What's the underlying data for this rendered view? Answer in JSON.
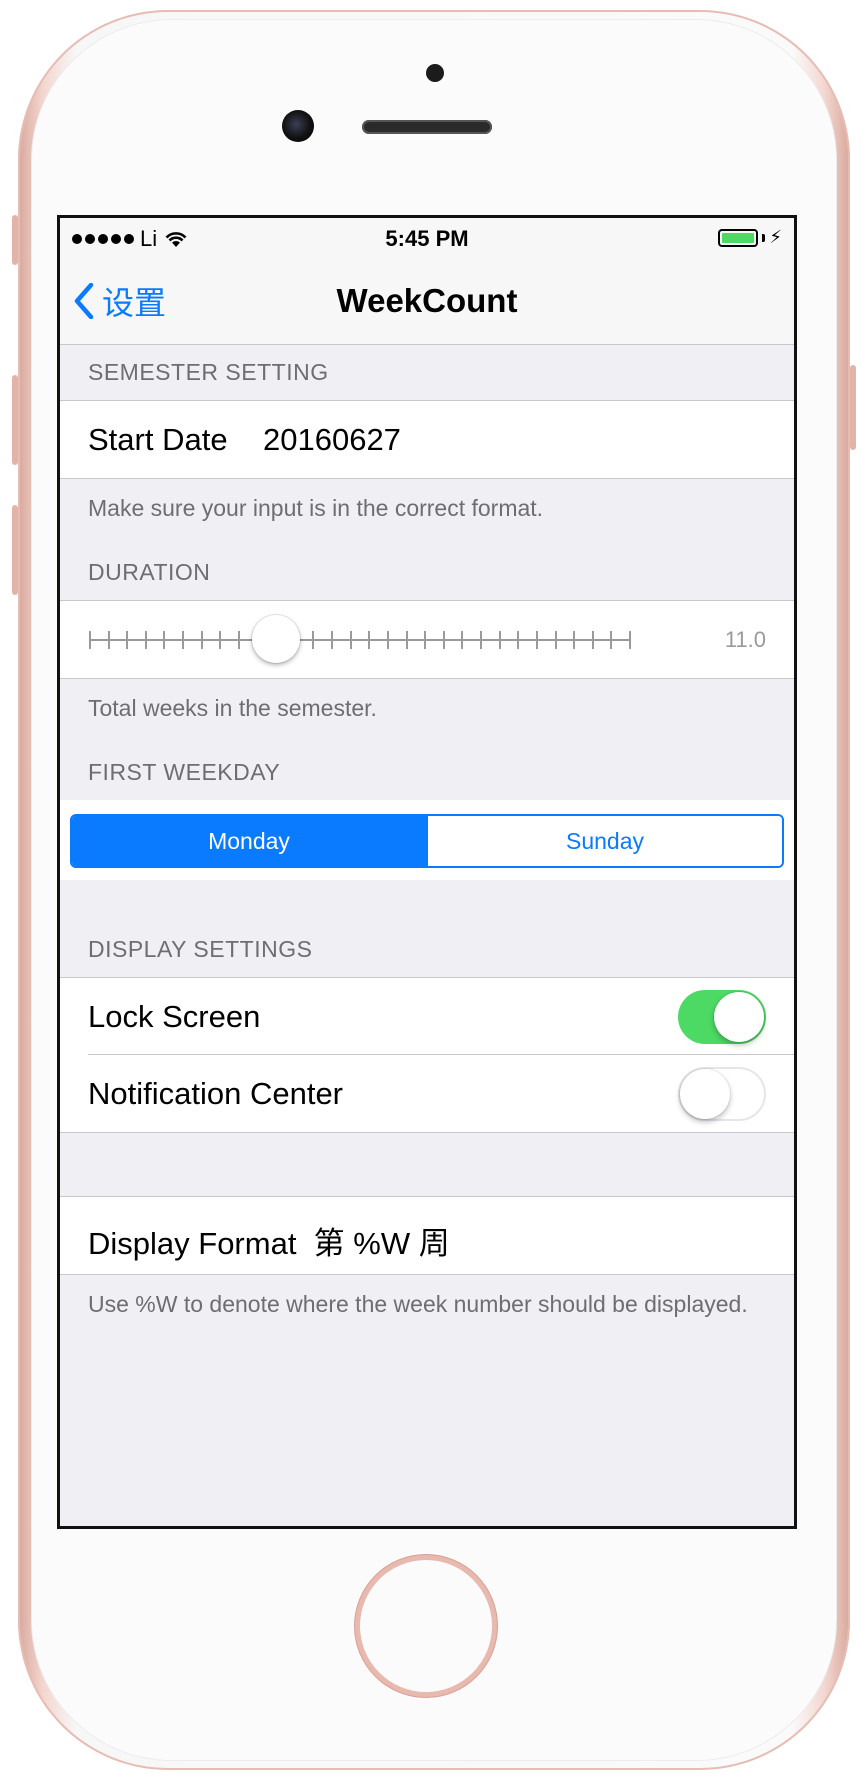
{
  "status_bar": {
    "carrier": "Li",
    "time": "5:45 PM",
    "battery_color": "#4cd964",
    "icons": [
      "signal-dots-icon",
      "wifi-icon",
      "battery-icon",
      "charging-bolt-icon"
    ]
  },
  "nav": {
    "back_label": "设置",
    "title": "WeekCount"
  },
  "semester": {
    "header": "SEMESTER SETTING",
    "start_label": "Start Date",
    "start_value": "20160627",
    "footer": "Make sure your input is in the correct format."
  },
  "duration": {
    "header": "DURATION",
    "value_label": "11.0",
    "value": 11,
    "min": 1,
    "max": 30,
    "footer": "Total weeks in the semester."
  },
  "weekday": {
    "header": "FIRST WEEKDAY",
    "options": [
      "Monday",
      "Sunday"
    ],
    "selected": "Monday"
  },
  "display": {
    "header": "DISPLAY SETTINGS",
    "lock_label": "Lock Screen",
    "lock_on": true,
    "notif_label": "Notification Center",
    "notif_on": false
  },
  "format": {
    "label": "Display Format",
    "value": "第 %W 周",
    "footer": "Use %W to denote where the week number should be displayed."
  },
  "colors": {
    "accent": "#0a7aff",
    "switch_on": "#4cd964",
    "group_bg": "#efeff4",
    "phone_frame": "#e7bdb3"
  }
}
